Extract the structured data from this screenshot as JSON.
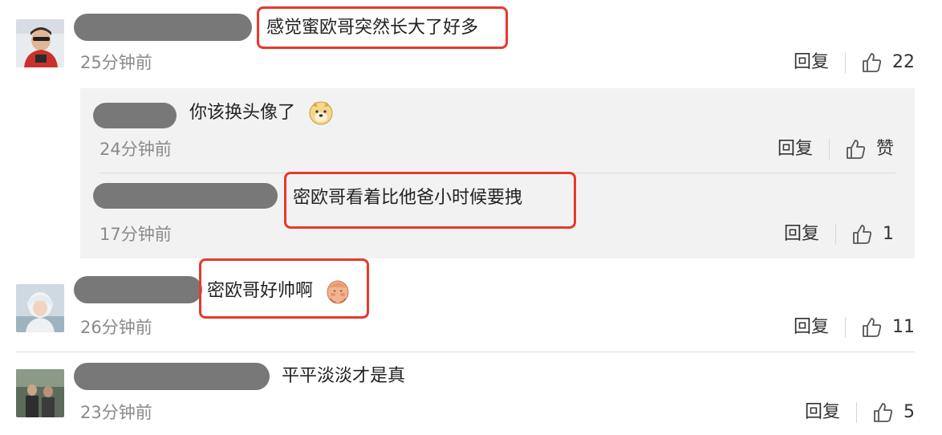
{
  "comments": [
    {
      "text": "感觉蜜欧哥突然长大了好多",
      "time": "25分钟前",
      "reply": "回复",
      "likes": "22"
    },
    {
      "text": "密欧哥好帅啊",
      "time": "26分钟前",
      "reply": "回复",
      "likes": "11"
    },
    {
      "text": "平平淡淡才是真",
      "time": "23分钟前",
      "reply": "回复",
      "likes": "5"
    }
  ],
  "replies": [
    {
      "text": "你该换头像了",
      "time": "24分钟前",
      "reply": "回复",
      "likes": "赞"
    },
    {
      "text": "密欧哥看着比他爸小时候要拽",
      "time": "17分钟前",
      "reply": "回复",
      "likes": "1"
    }
  ],
  "colors": {
    "highlight": "#e8392b",
    "reply_bg": "#f2f2f2",
    "redaction": "#787878",
    "meta_text": "#8a8a8a"
  },
  "icons": [
    "thumbs-up-icon",
    "doge-emoji",
    "shy-emoji"
  ]
}
